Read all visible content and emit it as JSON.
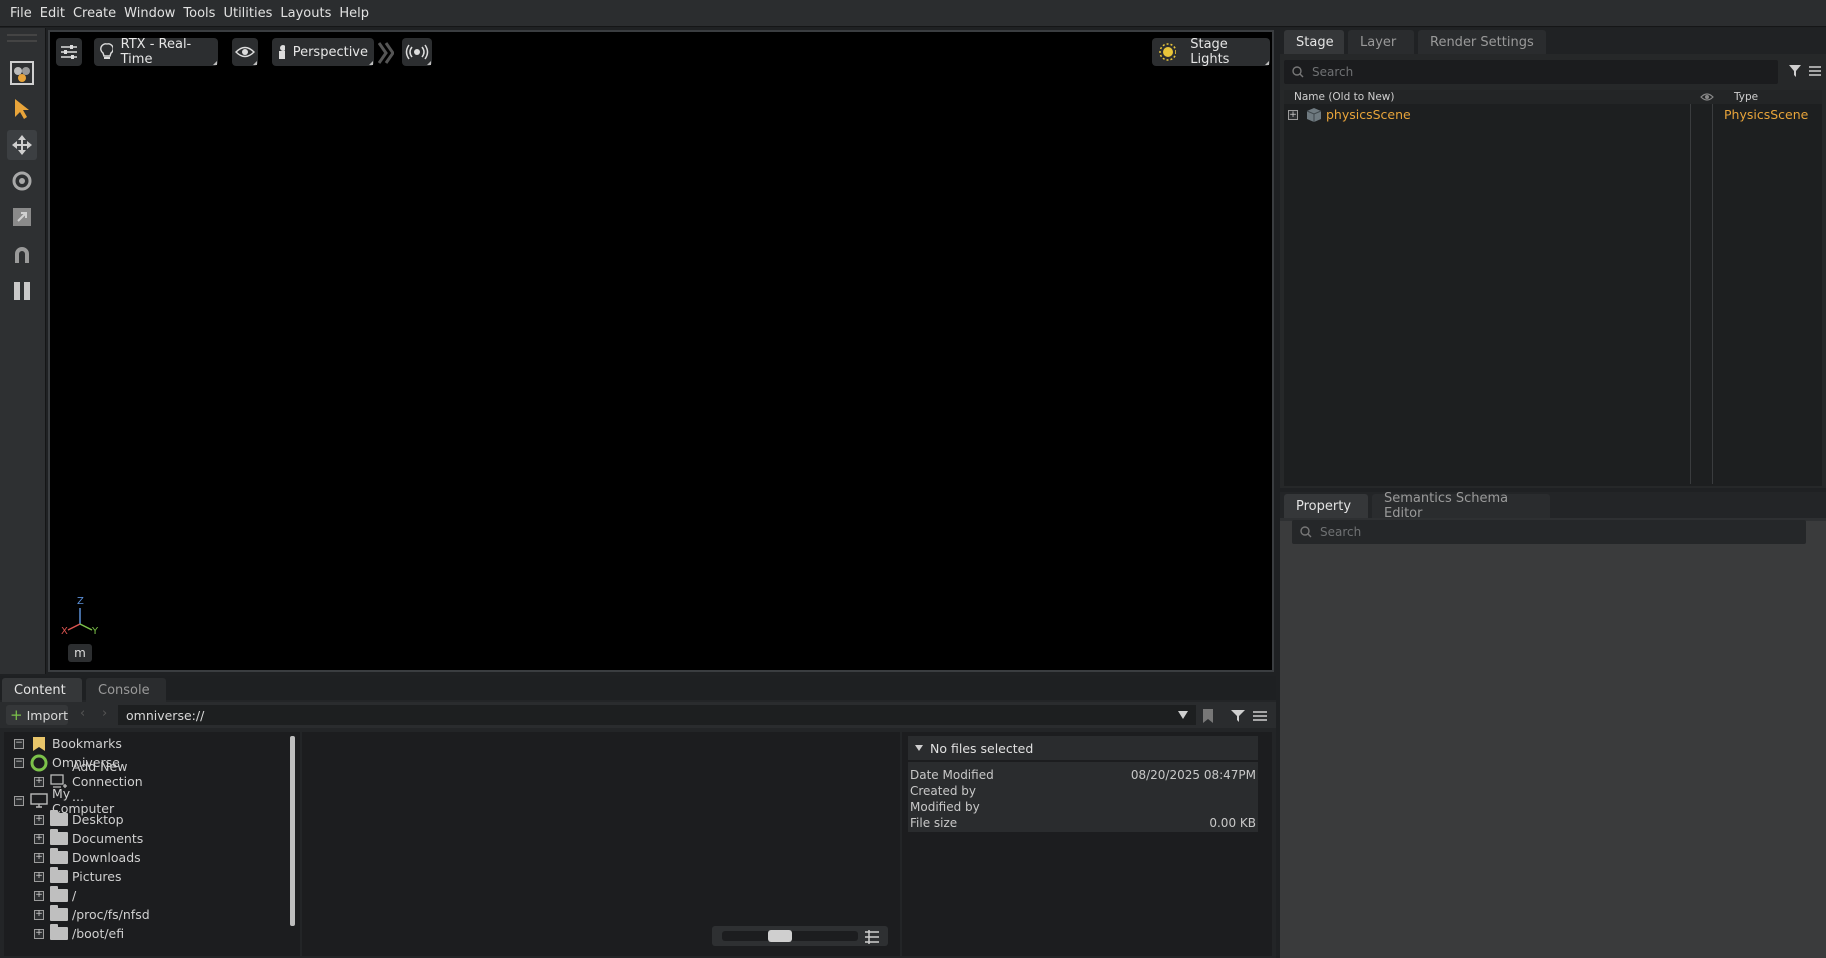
{
  "menu": [
    "File",
    "Edit",
    "Create",
    "Window",
    "Tools",
    "Utilities",
    "Layouts",
    "Help"
  ],
  "viewport": {
    "renderer": "RTX - Real-Time",
    "camera": "Perspective",
    "lights": "Stage Lights",
    "axis": {
      "z": "Z",
      "x": "X",
      "y": "Y"
    },
    "unit": "m",
    "colors": {
      "accent_orange": "#e8a43a",
      "axis_x": "#d9534f",
      "axis_y": "#7cc24a",
      "axis_z": "#5b8fd6"
    }
  },
  "stage": {
    "tabs": [
      "Stage",
      "Layer",
      "Render Settings"
    ],
    "search_placeholder": "Search",
    "columns": {
      "name": "Name (Old to New)",
      "type": "Type"
    },
    "rows": [
      {
        "name": "physicsScene",
        "type": "PhysicsScene"
      }
    ]
  },
  "property": {
    "tabs": [
      "Property",
      "Semantics Schema Editor"
    ],
    "search_placeholder": "Search"
  },
  "content": {
    "tabs": [
      "Content",
      "Console"
    ],
    "import_label": "Import",
    "path": "omniverse://",
    "tree": [
      {
        "label": "Bookmarks",
        "level": 0,
        "icon": "bookmark-icon"
      },
      {
        "label": "Omniverse",
        "level": 0,
        "icon": "omniverse-icon"
      },
      {
        "label": "Add New Connection ...",
        "level": 1,
        "icon": "connection-icon"
      },
      {
        "label": "My Computer",
        "level": 0,
        "icon": "monitor-icon"
      },
      {
        "label": "Desktop",
        "level": 1,
        "icon": "folder-icon"
      },
      {
        "label": "Documents",
        "level": 1,
        "icon": "folder-icon"
      },
      {
        "label": "Downloads",
        "level": 1,
        "icon": "folder-icon"
      },
      {
        "label": "Pictures",
        "level": 1,
        "icon": "folder-icon"
      },
      {
        "label": "/",
        "level": 1,
        "icon": "folder-icon"
      },
      {
        "label": "/proc/fs/nfsd",
        "level": 1,
        "icon": "folder-icon"
      },
      {
        "label": "/boot/efi",
        "level": 1,
        "icon": "folder-icon"
      }
    ],
    "details": {
      "header": "No files selected",
      "rows": [
        {
          "label": "Date Modified",
          "value": "08/20/2025 08:47PM"
        },
        {
          "label": "Created by",
          "value": ""
        },
        {
          "label": "Modified by",
          "value": ""
        },
        {
          "label": "File size",
          "value": "0.00 KB"
        }
      ]
    }
  }
}
